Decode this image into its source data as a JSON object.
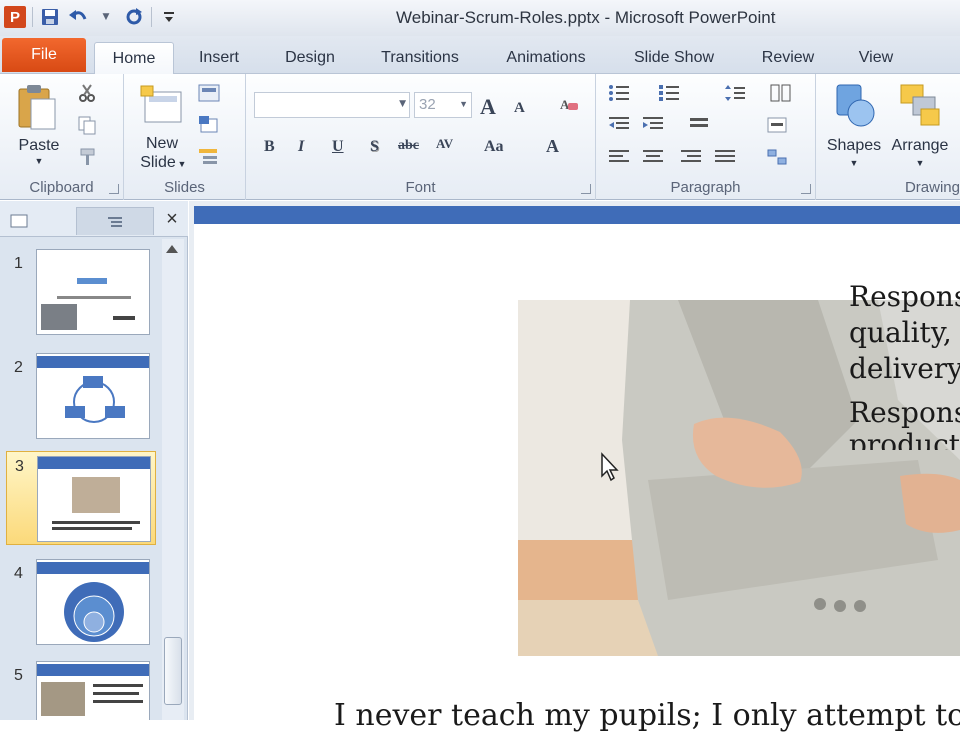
{
  "window": {
    "title": "Webinar-Scrum-Roles.pptx - Microsoft PowerPoint"
  },
  "quick_access": {
    "app_icon": "P"
  },
  "tabs": [
    "File",
    "Home",
    "Insert",
    "Design",
    "Transitions",
    "Animations",
    "Slide Show",
    "Review",
    "View"
  ],
  "active_tab": "Home",
  "ribbon": {
    "clipboard": {
      "label": "Clipboard",
      "paste": "Paste"
    },
    "slides": {
      "label": "Slides",
      "new_slide_line1": "New",
      "new_slide_line2": "Slide"
    },
    "font": {
      "label": "Font",
      "font_name": "",
      "font_size": "32",
      "bold": "B",
      "italic": "I",
      "underline": "U",
      "shadow": "S",
      "strike": "abc",
      "spacing": "AV",
      "case": "Aa",
      "color": "A",
      "grow": "A",
      "shrink": "A"
    },
    "paragraph": {
      "label": "Paragraph"
    },
    "drawing": {
      "label": "Drawing",
      "shapes": "Shapes",
      "arrange": "Arrange"
    }
  },
  "slides_pane": {
    "thumbnails": [
      {
        "number": "1",
        "selected": false
      },
      {
        "number": "2",
        "selected": false
      },
      {
        "number": "3",
        "selected": true
      },
      {
        "number": "4",
        "selected": false
      },
      {
        "number": "5",
        "selected": false
      }
    ],
    "close": "×"
  },
  "slide": {
    "text_lines": [
      "Respons",
      "quality,",
      "delivery",
      "Respons",
      "product"
    ],
    "quote": "I never teach my pupils; I only attempt to"
  },
  "colors": {
    "accent": "#3f6cb8",
    "file_tab": "#e2571e",
    "selection": "#fbd97a"
  }
}
